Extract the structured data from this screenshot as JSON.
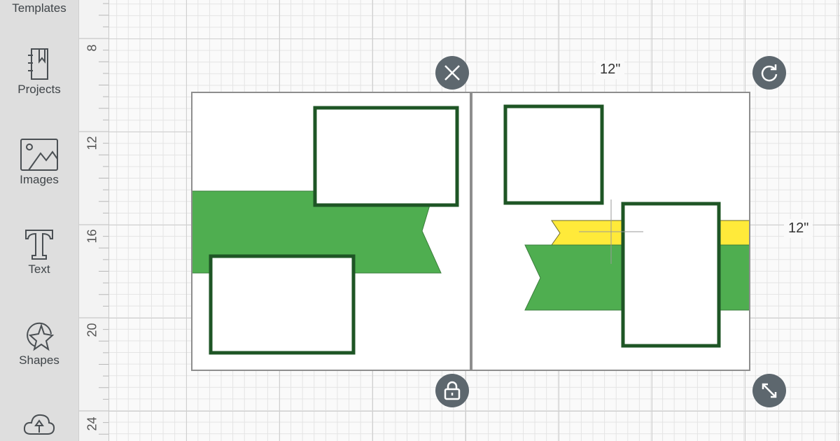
{
  "sidebar": {
    "items": [
      {
        "label": "Templates",
        "icon": "templates-icon"
      },
      {
        "label": "Projects",
        "icon": "notebook-icon"
      },
      {
        "label": "Images",
        "icon": "image-icon"
      },
      {
        "label": "Text",
        "icon": "text-t-icon"
      },
      {
        "label": "Shapes",
        "icon": "shapes-star-icon"
      },
      {
        "label": "",
        "icon": "cloud-upload-icon"
      }
    ]
  },
  "ruler": {
    "labels": [
      "8",
      "12",
      "16",
      "20",
      "24"
    ]
  },
  "selection": {
    "width_label": "12\"",
    "height_label": "12\"",
    "controls": {
      "delete": "close-icon",
      "rotate": "rotate-icon",
      "lock": "lock-icon",
      "resize": "resize-icon"
    }
  },
  "colors": {
    "green_fill": "#4fae50",
    "frame_stroke": "#1e5525",
    "yellow_fill": "#ffea3a",
    "control_bg": "#5d676e",
    "sidebar_bg": "#dedede"
  }
}
